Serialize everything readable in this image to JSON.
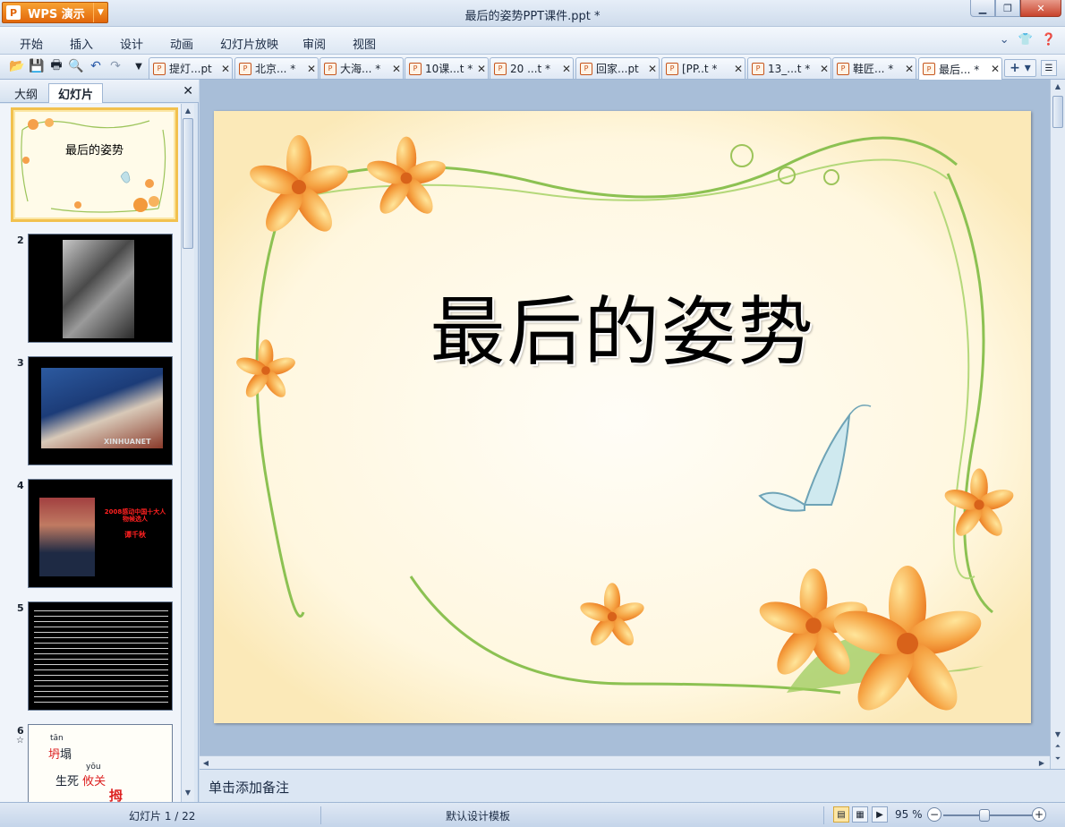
{
  "app": {
    "name": "WPS 演示",
    "logo_letter": "P"
  },
  "window": {
    "title": "最后的姿势PPT课件.ppt *"
  },
  "menu": [
    "开始",
    "插入",
    "设计",
    "动画",
    "幻灯片放映",
    "审阅",
    "视图"
  ],
  "doc_tabs": [
    {
      "label": "提灯...pt",
      "active": false
    },
    {
      "label": "北京... *",
      "active": false
    },
    {
      "label": "大海... *",
      "active": false
    },
    {
      "label": "10课...t *",
      "active": false
    },
    {
      "label": "20 ...t *",
      "active": false
    },
    {
      "label": "回家...pt",
      "active": false
    },
    {
      "label": "[PP..t *",
      "active": false
    },
    {
      "label": "13_...t *",
      "active": false
    },
    {
      "label": "鞋匠... *",
      "active": false
    },
    {
      "label": "最后... *",
      "active": true
    }
  ],
  "left_pane": {
    "tabs": [
      "大纲",
      "幻灯片"
    ],
    "active_tab": "幻灯片",
    "thumbnails": [
      {
        "num": "1",
        "text": "最后的姿势"
      },
      {
        "num": "2",
        "text": ""
      },
      {
        "num": "3",
        "text": "XINHUANET"
      },
      {
        "num": "4",
        "text": "2008感动中国十大人物候选人",
        "subtext": "谭千秋"
      },
      {
        "num": "5",
        "text": ""
      },
      {
        "num": "6",
        "pinyin1": "tān",
        "word1a": "坍",
        "word1b": "塌",
        "pinyin2": "yōu",
        "word2a": "生死",
        "word2b": "攸关",
        "word3": "拇"
      }
    ]
  },
  "slide": {
    "title": "最后的姿势"
  },
  "notes": {
    "placeholder": "单击添加备注"
  },
  "status": {
    "slide_position": "幻灯片 1 / 22",
    "template": "默认设计模板",
    "zoom": "95 %"
  },
  "colors": {
    "accent": "#e2670b",
    "selection": "#f2c14e",
    "chrome": "#c9d8ea"
  }
}
